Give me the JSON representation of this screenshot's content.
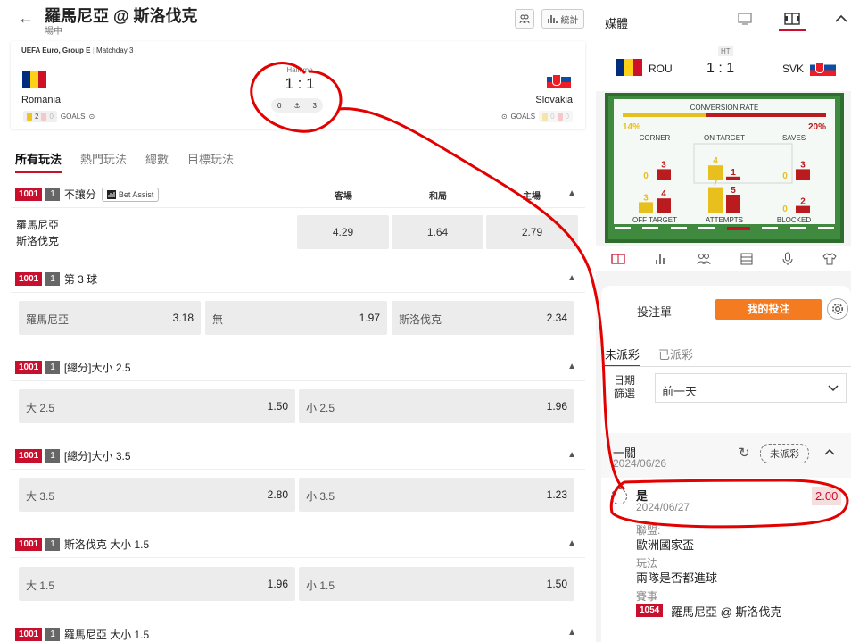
{
  "header": {
    "back": "←",
    "title": "羅馬尼亞 @ 斯洛伐克",
    "subtitle": "場中",
    "stats_label": "統計"
  },
  "match": {
    "competition": "UEFA Euro, Group E",
    "matchday": "Matchday 3",
    "home": {
      "name": "Romania",
      "yellow": "2",
      "red": "0",
      "goals_label": "GOALS"
    },
    "away": {
      "name": "Slovakia",
      "yellow": "0",
      "red": "0",
      "goals_label": "GOALS"
    },
    "status": "Halftime",
    "score": "1 : 1",
    "corners_home": "0",
    "corners_away": "3"
  },
  "tabs": [
    "所有玩法",
    "熱門玩法",
    "總數",
    "目標玩法"
  ],
  "markets": [
    {
      "id": "1001",
      "num": "1",
      "name": "不讓分",
      "assist": "Bet Assist",
      "cols": [
        "客場",
        "和局",
        "主場"
      ],
      "team1": "羅馬尼亞",
      "team2": "斯洛伐克",
      "odds": [
        "4.29",
        "1.64",
        "2.79"
      ]
    },
    {
      "id": "1001",
      "num": "1",
      "name": "第 3 球",
      "opts": [
        {
          "l": "羅馬尼亞",
          "v": "3.18"
        },
        {
          "l": "無",
          "v": "1.97"
        },
        {
          "l": "斯洛伐克",
          "v": "2.34"
        }
      ]
    },
    {
      "id": "1001",
      "num": "1",
      "name": "[總分]大小 2.5",
      "opts": [
        {
          "l": "大 2.5",
          "v": "1.50"
        },
        {
          "l": "小 2.5",
          "v": "1.96"
        }
      ]
    },
    {
      "id": "1001",
      "num": "1",
      "name": "[總分]大小 3.5",
      "opts": [
        {
          "l": "大 3.5",
          "v": "2.80"
        },
        {
          "l": "小 3.5",
          "v": "1.23"
        }
      ]
    },
    {
      "id": "1001",
      "num": "1",
      "name": "斯洛伐克 大小 1.5",
      "opts": [
        {
          "l": "大 1.5",
          "v": "1.96"
        },
        {
          "l": "小 1.5",
          "v": "1.50"
        }
      ]
    },
    {
      "id": "1001",
      "num": "1",
      "name": "羅馬尼亞 大小 1.5"
    }
  ],
  "media": {
    "title": "媒體",
    "ht": "HT",
    "home_code": "ROU",
    "away_code": "SVK",
    "score": "1 : 1",
    "conversion": {
      "label": "CONVERSION RATE",
      "home": "14%",
      "away": "20%",
      "home_fraction": 0.14,
      "away_fraction": 0.2
    },
    "stats": [
      {
        "label": "CORNER",
        "home": 0,
        "away": 3
      },
      {
        "label": "ON TARGET",
        "home": 4,
        "away": 1
      },
      {
        "label": "SAVES",
        "home": 0,
        "away": 3
      },
      {
        "label": "OFF TARGET",
        "home": 3,
        "away": 4
      },
      {
        "label": "ATTEMPTS",
        "home": 7,
        "away": 5
      },
      {
        "label": "BLOCKED",
        "home": 0,
        "away": 2
      }
    ],
    "colors": {
      "home": "#f2c31c",
      "away": "#c0161d"
    }
  },
  "betslip": {
    "tab1": "投注單",
    "tab2": "我的投注",
    "sub1": "未派彩",
    "sub2": "已派彩",
    "filter_label": "日期\n篩選",
    "filter_value": "前一天",
    "bet_type": "一關",
    "bet_date": "2024/06/26",
    "status": "未派彩",
    "selection": "是",
    "sel_date": "2024/06/27",
    "price": "2.00",
    "league_label": "聯盟:",
    "league": "歐洲國家盃",
    "play_label": "玩法",
    "play": "兩隊是否都進球",
    "event_label": "賽事",
    "event_id": "1054",
    "event": "羅馬尼亞 @ 斯洛伐克"
  }
}
